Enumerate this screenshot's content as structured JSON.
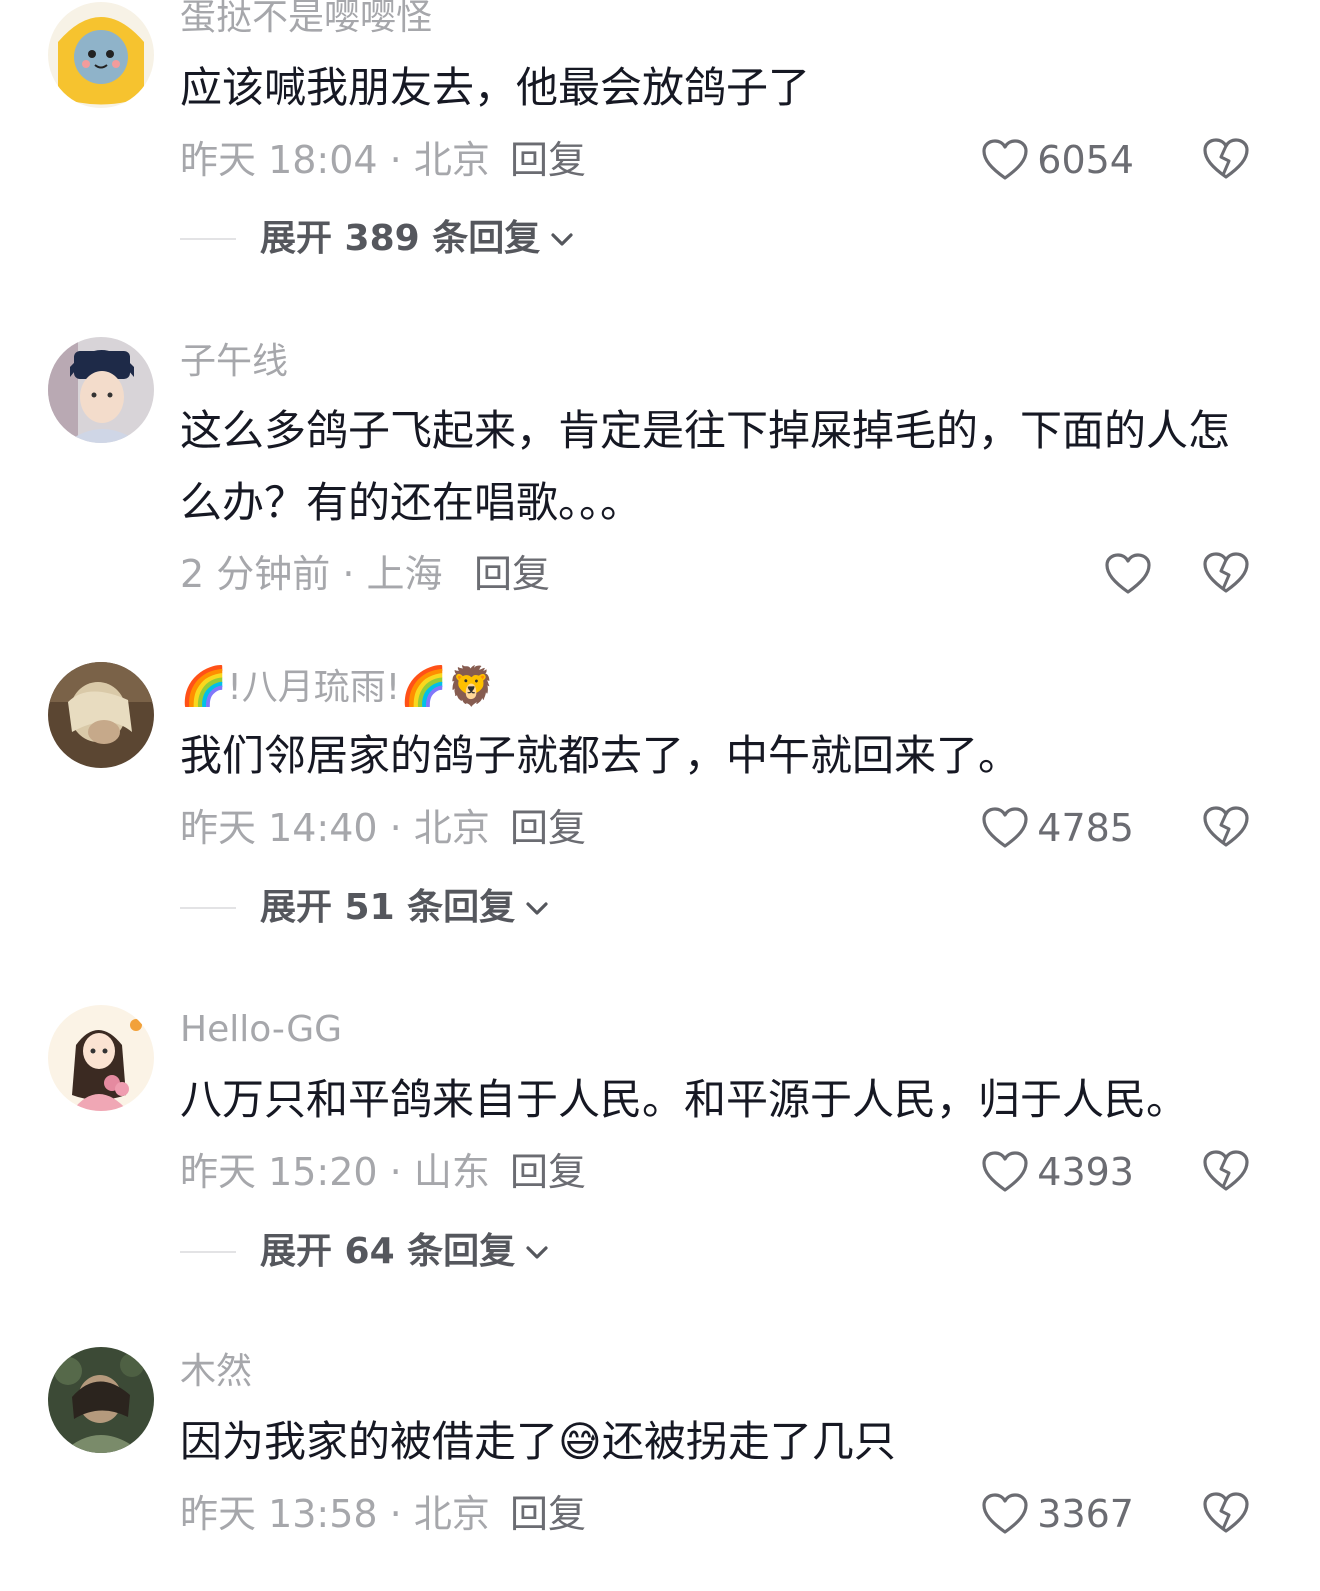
{
  "comments": [
    {
      "username": "蛋挞不是嘤嘤怪",
      "text": "应该喊我朋友去，他最会放鸽子了",
      "time_loc": "昨天 18:04 · 北京",
      "reply_label": "回复",
      "likes": "6054",
      "expand_label": "展开 389 条回复"
    },
    {
      "username": "子午线",
      "text": "这么多鸽子飞起来，肯定是往下掉屎掉毛的，下面的人怎么办？有的还在唱歌。。。",
      "time_loc": "2 分钟前 · 上海",
      "reply_label": "回复",
      "likes": ""
    },
    {
      "username": "!八月琉雨!",
      "username_emoji_before": "🌈",
      "username_emoji_after": "🌈🦁",
      "text": "我们邻居家的鸽子就都去了，中午就回来了。",
      "time_loc": "昨天 14:40 · 北京",
      "reply_label": "回复",
      "likes": "4785",
      "expand_label": "展开 51 条回复"
    },
    {
      "username": "Hello-GG",
      "text": "八万只和平鸽来自于人民。和平源于人民，归于人民。",
      "time_loc": "昨天 15:20 · 山东",
      "reply_label": "回复",
      "likes": "4393",
      "expand_label": "展开 64 条回复"
    },
    {
      "username": "木然",
      "text_before": "因为我家的被借走了",
      "text_emoji": "😅",
      "text_after": "还被拐走了几只",
      "time_loc": "昨天 13:58 · 北京",
      "reply_label": "回复",
      "likes": "3367"
    }
  ],
  "icons": {
    "like": "heart-outline-icon",
    "dislike": "broken-heart-icon",
    "expand": "chevron-down-icon"
  },
  "colors": {
    "meta_gray": "#a6a7ab",
    "text_dark": "#161823",
    "action_gray": "#6b6c72"
  }
}
